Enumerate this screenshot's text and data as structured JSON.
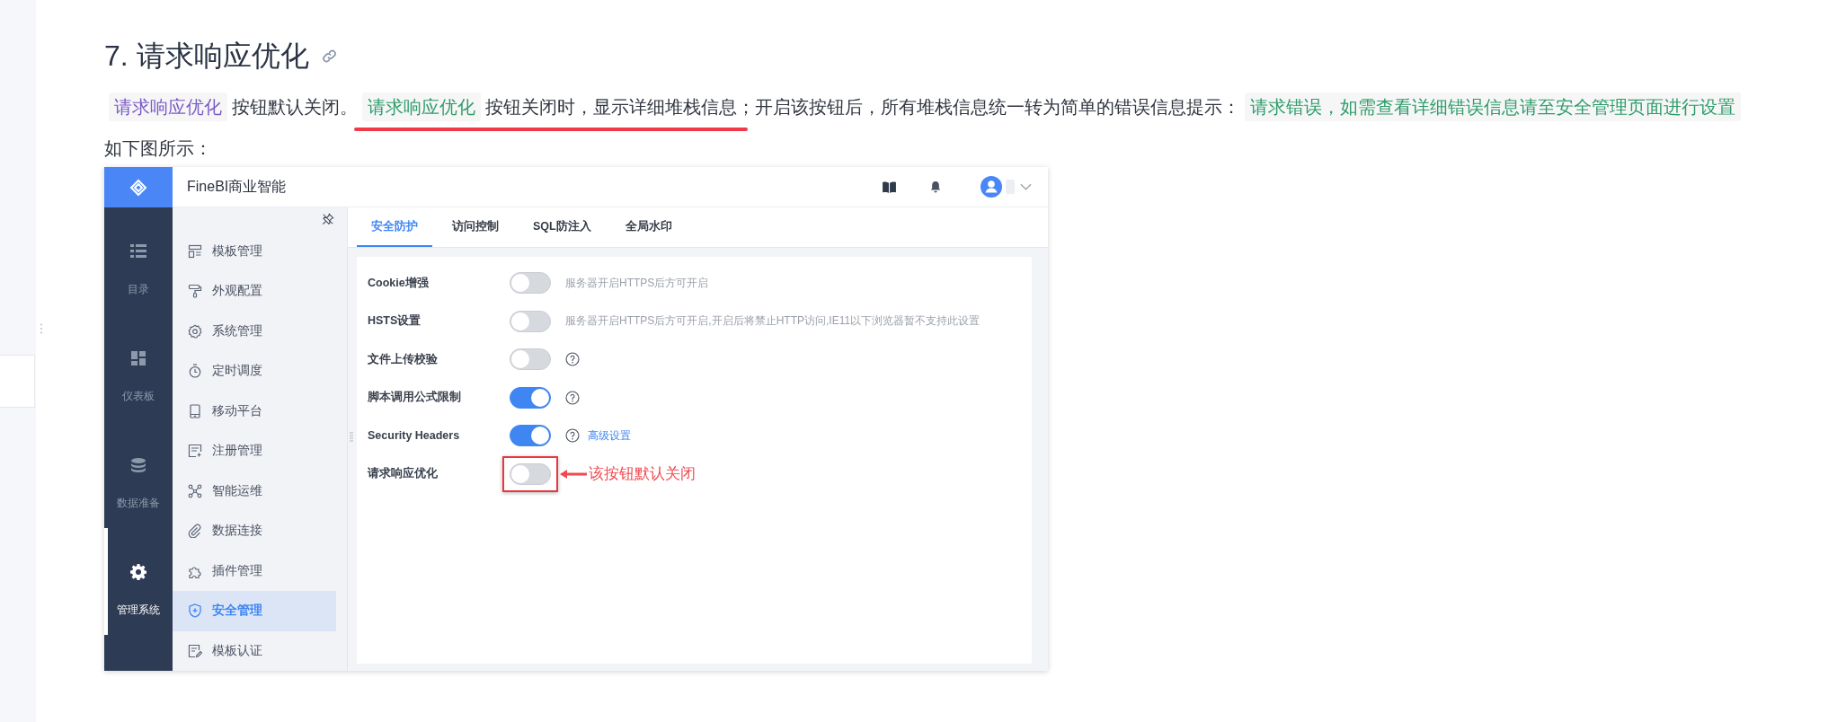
{
  "heading": {
    "title": "7. 请求响应优化"
  },
  "paragraph": [
    {
      "kind": "code",
      "text": "请求响应优化",
      "color": "#7a5bc4"
    },
    {
      "kind": "text",
      "text": "按钮默认关闭。"
    },
    {
      "kind": "underlined",
      "children": [
        {
          "kind": "code",
          "text": "请求响应优化",
          "color": "#2e9c6a"
        },
        {
          "kind": "text",
          "text": "按钮关闭时，显示详细堆栈信息"
        }
      ]
    },
    {
      "kind": "text",
      "text": "；开启该按钮后，所有堆栈信息统一转为简单的错误信息提示："
    },
    {
      "kind": "code",
      "text": "请求错误，如需查看详细错误信息请至安全管理页面进行设置",
      "color": "#2e9c6a"
    }
  ],
  "caption": "如下图所示：",
  "app": {
    "product": "FineBI商业智能",
    "rail": [
      {
        "label": "目录",
        "selected": false
      },
      {
        "label": "仪表板",
        "selected": false
      },
      {
        "label": "数据准备",
        "selected": false
      },
      {
        "label": "管理系统",
        "selected": true
      }
    ],
    "menu": [
      {
        "label": "模板管理",
        "selected": false
      },
      {
        "label": "外观配置",
        "selected": false
      },
      {
        "label": "系统管理",
        "selected": false
      },
      {
        "label": "定时调度",
        "selected": false
      },
      {
        "label": "移动平台",
        "selected": false
      },
      {
        "label": "注册管理",
        "selected": false
      },
      {
        "label": "智能运维",
        "selected": false
      },
      {
        "label": "数据连接",
        "selected": false
      },
      {
        "label": "插件管理",
        "selected": false
      },
      {
        "label": "安全管理",
        "selected": true
      },
      {
        "label": "模板认证",
        "selected": false
      }
    ],
    "tabs": [
      {
        "label": "安全防护",
        "selected": true
      },
      {
        "label": "访问控制",
        "selected": false
      },
      {
        "label": "SQL防注入",
        "selected": false
      },
      {
        "label": "全局水印",
        "selected": false
      }
    ],
    "settings": [
      {
        "label": "Cookie增强",
        "on": false,
        "help": false,
        "hint": "服务器开启HTTPS后方可开启",
        "highlighted": false
      },
      {
        "label": "HSTS设置",
        "on": false,
        "help": false,
        "hint": "服务器开启HTTPS后方可开启,开启后将禁止HTTP访问,IE11以下浏览器暂不支持此设置",
        "highlighted": false
      },
      {
        "label": "文件上传校验",
        "on": false,
        "help": true,
        "highlighted": false
      },
      {
        "label": "脚本调用公式限制",
        "on": true,
        "help": true,
        "highlighted": false
      },
      {
        "label": "Security Headers",
        "on": true,
        "help": true,
        "link": "高级设置",
        "highlighted": false
      },
      {
        "label": "请求响应优化",
        "on": false,
        "help": false,
        "highlighted": true
      }
    ],
    "annotation": "该按钮默认关闭"
  }
}
